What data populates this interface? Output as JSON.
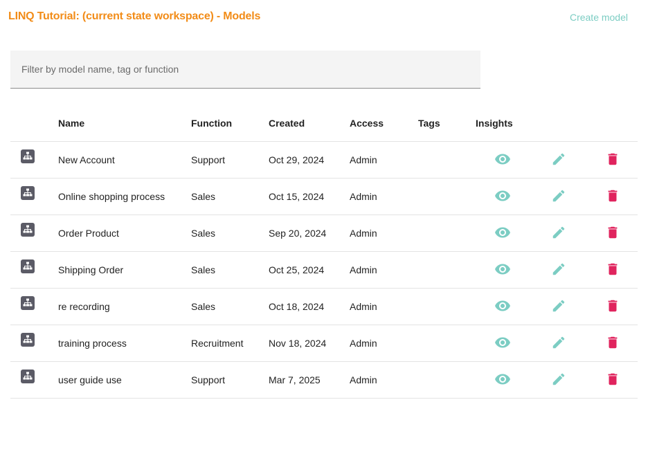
{
  "header": {
    "title": "LINQ Tutorial: (current state workspace) - Models",
    "create_label": "Create model"
  },
  "filter": {
    "placeholder": "Filter by model name, tag or function",
    "value": ""
  },
  "table": {
    "columns": [
      "",
      "Name",
      "Function",
      "Created",
      "Access",
      "Tags",
      "Insights",
      "",
      ""
    ],
    "rows": [
      {
        "name": "New Account",
        "function": "Support",
        "created": "Oct 29, 2024",
        "access": "Admin",
        "tags": ""
      },
      {
        "name": "Online shopping process",
        "function": "Sales",
        "created": "Oct 15, 2024",
        "access": "Admin",
        "tags": ""
      },
      {
        "name": "Order Product",
        "function": "Sales",
        "created": "Sep 20, 2024",
        "access": "Admin",
        "tags": ""
      },
      {
        "name": "Shipping Order",
        "function": "Sales",
        "created": "Oct 25, 2024",
        "access": "Admin",
        "tags": ""
      },
      {
        "name": "re recording",
        "function": "Sales",
        "created": "Oct 18, 2024",
        "access": "Admin",
        "tags": ""
      },
      {
        "name": "training process",
        "function": "Recruitment",
        "created": "Nov 18, 2024",
        "access": "Admin",
        "tags": ""
      },
      {
        "name": "user guide use",
        "function": "Support",
        "created": "Mar 7, 2025",
        "access": "Admin",
        "tags": ""
      }
    ]
  },
  "icons": {
    "model": "org-chart-icon",
    "insights": "eye-icon",
    "edit": "pencil-icon",
    "delete": "trash-icon"
  },
  "colors": {
    "title": "#f28c18",
    "accent": "#7ccdc3",
    "delete": "#e0245e",
    "model_icon_bg": "#5b5b66"
  }
}
